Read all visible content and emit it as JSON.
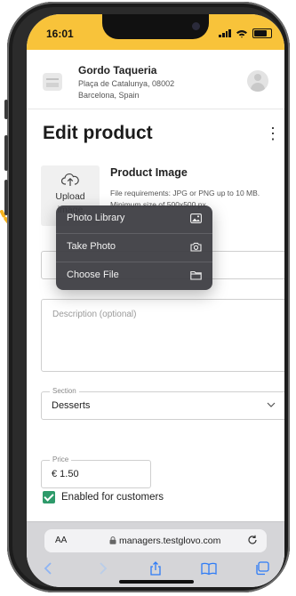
{
  "status_bar": {
    "time": "16:01"
  },
  "store": {
    "name": "Gordo Taqueria",
    "address": "Plaça de Catalunya, 08002 Barcelona, Spain"
  },
  "page": {
    "title": "Edit product",
    "more_label": "⋮"
  },
  "product_image": {
    "upload_label_line1": "Upload",
    "upload_label_line2": "image",
    "title": "Product Image",
    "requirements": "File requirements: JPG or PNG up to 10 MB. Minimum size of 500x500 px"
  },
  "menu": {
    "items": [
      {
        "label": "Photo Library",
        "icon": "photo-library-icon"
      },
      {
        "label": "Take Photo",
        "icon": "camera-icon"
      },
      {
        "label": "Choose File",
        "icon": "folder-icon"
      }
    ]
  },
  "form": {
    "description_placeholder": "Description (optional)",
    "section_label": "Section",
    "section_value": "Desserts",
    "price_label": "Price",
    "price_value": "€ 1.50",
    "enabled_label": "Enabled for customers",
    "enabled_checked": true
  },
  "safari": {
    "aa_label": "AA",
    "url": "managers.testglovo.com"
  },
  "colors": {
    "status_bar_bg": "#f8c33a",
    "checkbox_green": "#2e9a6a",
    "safari_icon_blue": "#2f7cf6",
    "annotation_orange": "#f5b21c"
  }
}
